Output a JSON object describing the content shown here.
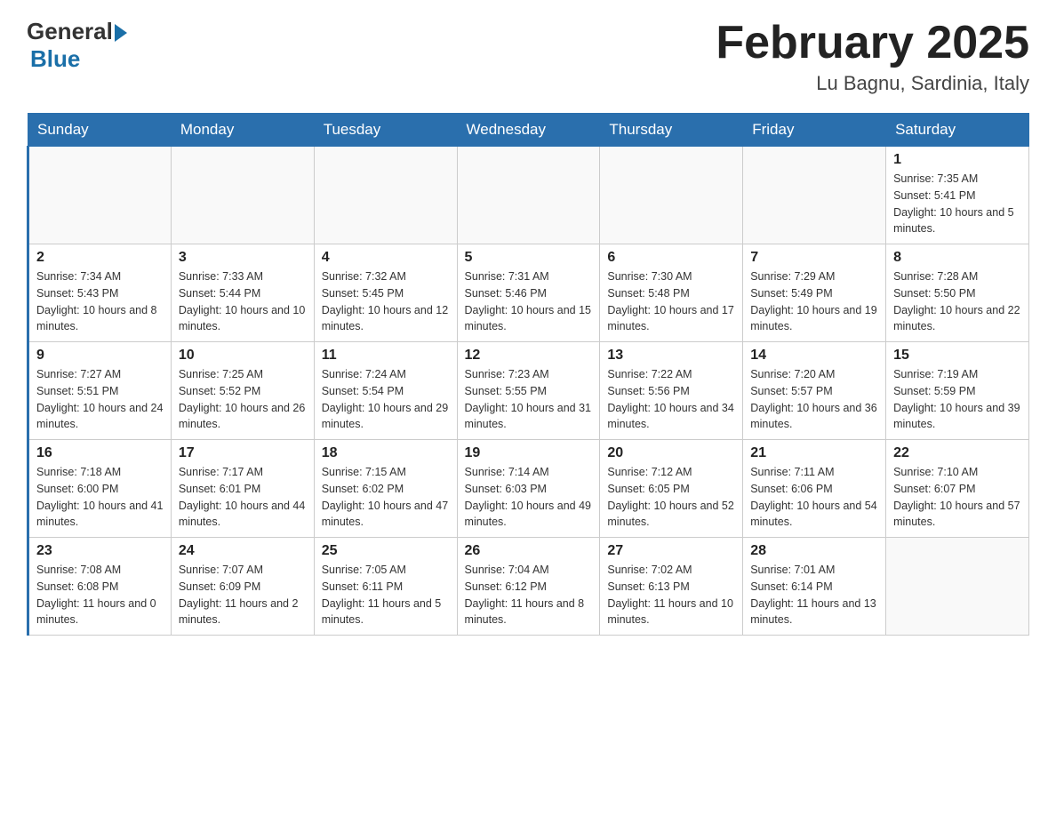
{
  "header": {
    "logo": {
      "general": "General",
      "blue": "Blue"
    },
    "title": "February 2025",
    "location": "Lu Bagnu, Sardinia, Italy"
  },
  "days_of_week": [
    "Sunday",
    "Monday",
    "Tuesday",
    "Wednesday",
    "Thursday",
    "Friday",
    "Saturday"
  ],
  "weeks": [
    [
      {
        "day": "",
        "info": ""
      },
      {
        "day": "",
        "info": ""
      },
      {
        "day": "",
        "info": ""
      },
      {
        "day": "",
        "info": ""
      },
      {
        "day": "",
        "info": ""
      },
      {
        "day": "",
        "info": ""
      },
      {
        "day": "1",
        "info": "Sunrise: 7:35 AM\nSunset: 5:41 PM\nDaylight: 10 hours and 5 minutes."
      }
    ],
    [
      {
        "day": "2",
        "info": "Sunrise: 7:34 AM\nSunset: 5:43 PM\nDaylight: 10 hours and 8 minutes."
      },
      {
        "day": "3",
        "info": "Sunrise: 7:33 AM\nSunset: 5:44 PM\nDaylight: 10 hours and 10 minutes."
      },
      {
        "day": "4",
        "info": "Sunrise: 7:32 AM\nSunset: 5:45 PM\nDaylight: 10 hours and 12 minutes."
      },
      {
        "day": "5",
        "info": "Sunrise: 7:31 AM\nSunset: 5:46 PM\nDaylight: 10 hours and 15 minutes."
      },
      {
        "day": "6",
        "info": "Sunrise: 7:30 AM\nSunset: 5:48 PM\nDaylight: 10 hours and 17 minutes."
      },
      {
        "day": "7",
        "info": "Sunrise: 7:29 AM\nSunset: 5:49 PM\nDaylight: 10 hours and 19 minutes."
      },
      {
        "day": "8",
        "info": "Sunrise: 7:28 AM\nSunset: 5:50 PM\nDaylight: 10 hours and 22 minutes."
      }
    ],
    [
      {
        "day": "9",
        "info": "Sunrise: 7:27 AM\nSunset: 5:51 PM\nDaylight: 10 hours and 24 minutes."
      },
      {
        "day": "10",
        "info": "Sunrise: 7:25 AM\nSunset: 5:52 PM\nDaylight: 10 hours and 26 minutes."
      },
      {
        "day": "11",
        "info": "Sunrise: 7:24 AM\nSunset: 5:54 PM\nDaylight: 10 hours and 29 minutes."
      },
      {
        "day": "12",
        "info": "Sunrise: 7:23 AM\nSunset: 5:55 PM\nDaylight: 10 hours and 31 minutes."
      },
      {
        "day": "13",
        "info": "Sunrise: 7:22 AM\nSunset: 5:56 PM\nDaylight: 10 hours and 34 minutes."
      },
      {
        "day": "14",
        "info": "Sunrise: 7:20 AM\nSunset: 5:57 PM\nDaylight: 10 hours and 36 minutes."
      },
      {
        "day": "15",
        "info": "Sunrise: 7:19 AM\nSunset: 5:59 PM\nDaylight: 10 hours and 39 minutes."
      }
    ],
    [
      {
        "day": "16",
        "info": "Sunrise: 7:18 AM\nSunset: 6:00 PM\nDaylight: 10 hours and 41 minutes."
      },
      {
        "day": "17",
        "info": "Sunrise: 7:17 AM\nSunset: 6:01 PM\nDaylight: 10 hours and 44 minutes."
      },
      {
        "day": "18",
        "info": "Sunrise: 7:15 AM\nSunset: 6:02 PM\nDaylight: 10 hours and 47 minutes."
      },
      {
        "day": "19",
        "info": "Sunrise: 7:14 AM\nSunset: 6:03 PM\nDaylight: 10 hours and 49 minutes."
      },
      {
        "day": "20",
        "info": "Sunrise: 7:12 AM\nSunset: 6:05 PM\nDaylight: 10 hours and 52 minutes."
      },
      {
        "day": "21",
        "info": "Sunrise: 7:11 AM\nSunset: 6:06 PM\nDaylight: 10 hours and 54 minutes."
      },
      {
        "day": "22",
        "info": "Sunrise: 7:10 AM\nSunset: 6:07 PM\nDaylight: 10 hours and 57 minutes."
      }
    ],
    [
      {
        "day": "23",
        "info": "Sunrise: 7:08 AM\nSunset: 6:08 PM\nDaylight: 11 hours and 0 minutes."
      },
      {
        "day": "24",
        "info": "Sunrise: 7:07 AM\nSunset: 6:09 PM\nDaylight: 11 hours and 2 minutes."
      },
      {
        "day": "25",
        "info": "Sunrise: 7:05 AM\nSunset: 6:11 PM\nDaylight: 11 hours and 5 minutes."
      },
      {
        "day": "26",
        "info": "Sunrise: 7:04 AM\nSunset: 6:12 PM\nDaylight: 11 hours and 8 minutes."
      },
      {
        "day": "27",
        "info": "Sunrise: 7:02 AM\nSunset: 6:13 PM\nDaylight: 11 hours and 10 minutes."
      },
      {
        "day": "28",
        "info": "Sunrise: 7:01 AM\nSunset: 6:14 PM\nDaylight: 11 hours and 13 minutes."
      },
      {
        "day": "",
        "info": ""
      }
    ]
  ]
}
